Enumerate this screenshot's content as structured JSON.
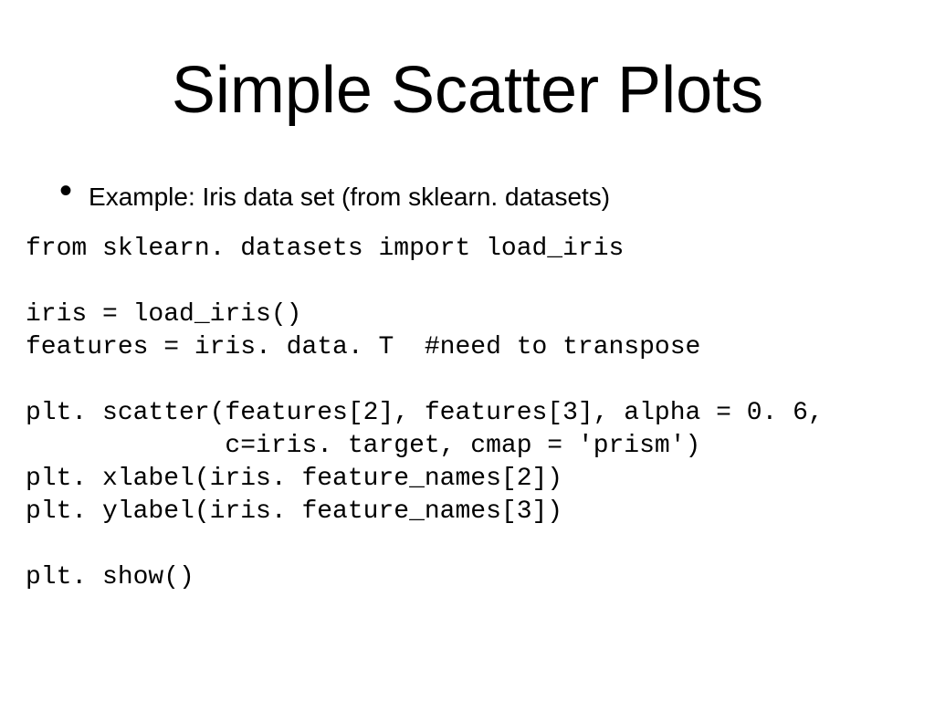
{
  "title": "Simple Scatter Plots",
  "bullet": "Example: Iris data set (from sklearn. datasets)",
  "code": "from sklearn. datasets import load_iris\n\niris = load_iris()\nfeatures = iris. data. T  #need to transpose\n\nplt. scatter(features[2], features[3], alpha = 0. 6,\n             c=iris. target, cmap = 'prism')\nplt. xlabel(iris. feature_names[2])\nplt. ylabel(iris. feature_names[3])\n\nplt. show()"
}
